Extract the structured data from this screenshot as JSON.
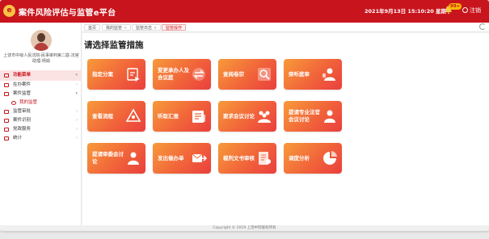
{
  "header": {
    "logo_text": "e",
    "title": "案件风险评估与监管e平台",
    "datetime": "2021年9月13日 15:10:20 星期一",
    "notification_count": "99+",
    "logout_label": "注销",
    "brand_color": "#c8141c"
  },
  "sidebar": {
    "user_name": "上饶市中级人民法院-民事审判第二庭-法官助理-杨娟",
    "items": [
      {
        "label": "功能菜单",
        "icon": "home-icon"
      },
      {
        "label": "在办案件",
        "icon": "case-icon"
      },
      {
        "label": "案件监管",
        "icon": "supervise-icon"
      },
      {
        "label": "我的监管",
        "icon": "circle-icon"
      },
      {
        "label": "监管审批",
        "icon": "approve-icon"
      },
      {
        "label": "案件识别",
        "icon": "identify-icon"
      },
      {
        "label": "党政服务",
        "icon": "service-icon"
      },
      {
        "label": "统计",
        "icon": "stats-icon"
      }
    ]
  },
  "tabs": [
    {
      "label": "首页"
    },
    {
      "label": "我的监管"
    },
    {
      "label": "监管日志"
    },
    {
      "label": "监管操作"
    }
  ],
  "main": {
    "title": "请选择监管措施",
    "cards": [
      {
        "label": "指定分案",
        "icon": "assign-icon"
      },
      {
        "label": "变更承办人及合议庭",
        "icon": "change-icon"
      },
      {
        "label": "查阅卷宗",
        "icon": "search-file-icon"
      },
      {
        "label": "旁听庭审",
        "icon": "audit-icon"
      },
      {
        "label": "查看流程",
        "icon": "flow-icon"
      },
      {
        "label": "听取汇报",
        "icon": "report-icon"
      },
      {
        "label": "要求会议讨论",
        "icon": "meeting-icon"
      },
      {
        "label": "提请专业法官会议讨论",
        "icon": "judge-meeting-icon"
      },
      {
        "label": "提请审委会讨论",
        "icon": "committee-icon"
      },
      {
        "label": "发出催办单",
        "icon": "urge-icon"
      },
      {
        "label": "裁判文书审核",
        "icon": "document-icon"
      },
      {
        "label": "调度分析",
        "icon": "chart-icon"
      }
    ]
  },
  "footer": {
    "copyright": "Copyright © 2019 上饶中院版权所有"
  }
}
